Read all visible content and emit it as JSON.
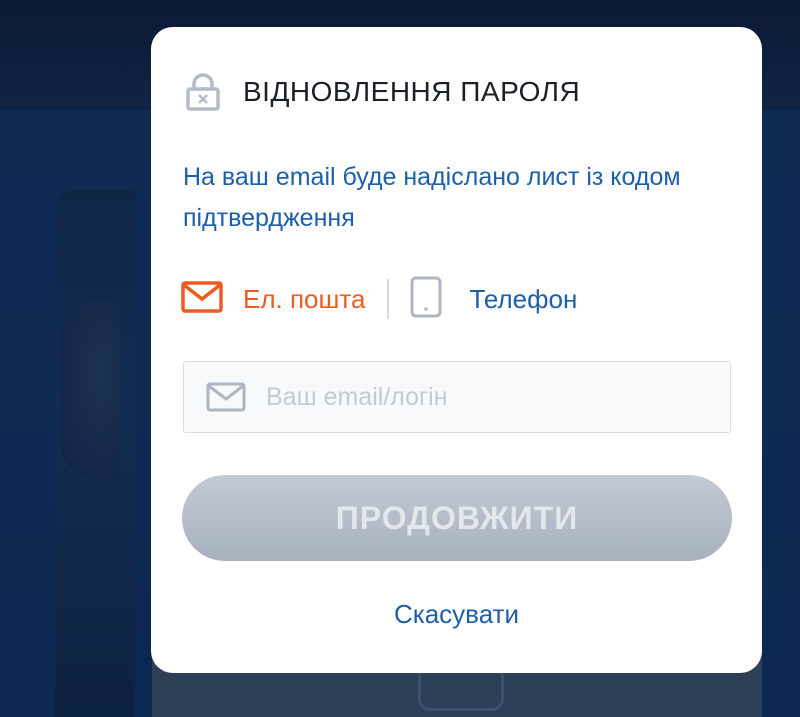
{
  "modal": {
    "title": "ВІДНОВЛЕННЯ ПАРОЛЯ",
    "title_icon": "lock-icon",
    "info_text": "На ваш email буде надіслано лист із кодом підтвердження",
    "methods": [
      {
        "label": "Ел. пошта",
        "icon": "envelope-icon",
        "active": true
      },
      {
        "label": "Телефон",
        "icon": "phone-icon",
        "active": false
      }
    ],
    "email_input": {
      "value": "",
      "placeholder": "Ваш email/логін",
      "icon": "envelope-icon"
    },
    "continue_label": "ПРОДОВЖИТИ",
    "cancel_label": "Скасувати"
  },
  "colors": {
    "accent_orange": "#ef5a21",
    "link_blue": "#1d5fa8",
    "button_disabled": "#b5bec9",
    "backdrop_navy": "#0e2548"
  }
}
